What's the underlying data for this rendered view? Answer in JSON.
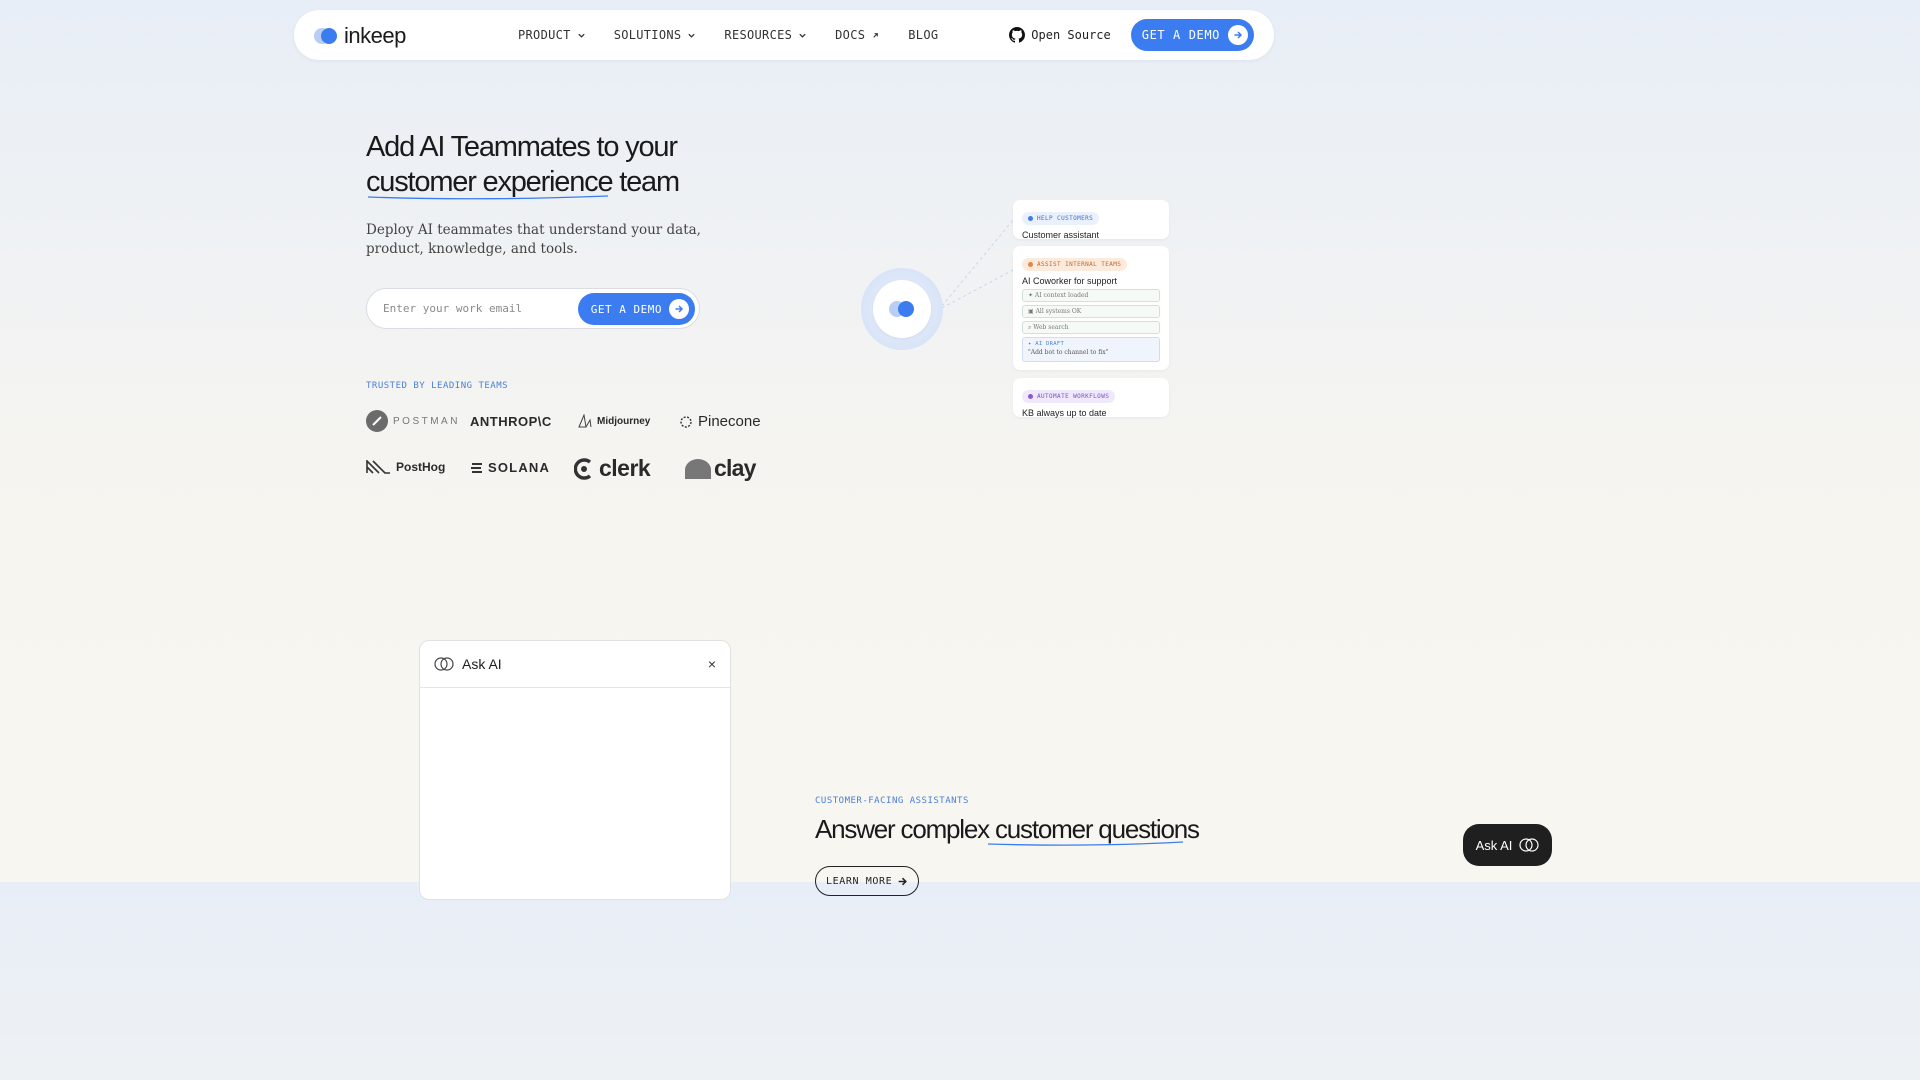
{
  "nav": {
    "logo_text": "inkeep",
    "menu": [
      {
        "label": "PRODUCT",
        "has_dropdown": true
      },
      {
        "label": "SOLUTIONS",
        "has_dropdown": true
      },
      {
        "label": "RESOURCES",
        "has_dropdown": true
      },
      {
        "label": "DOCS",
        "external": true
      },
      {
        "label": "BLOG"
      }
    ],
    "open_source_label": "Open Source",
    "demo_label": "GET A DEMO"
  },
  "hero": {
    "title_line1": "Add AI Teammates to your",
    "title_line2": "customer experience team",
    "subtitle": "Deploy AI teammates that understand your data, product, knowledge, and tools.",
    "email_placeholder": "Enter your work email",
    "form_button": "GET A DEMO",
    "trusted_label": "TRUSTED BY LEADING TEAMS",
    "brands": [
      "POSTMAN",
      "ANTHROP\\C",
      "Midjourney",
      "Pinecone",
      "PostHog",
      "SOLANA",
      "clerk",
      "clay"
    ]
  },
  "illustration": {
    "cards": [
      {
        "pill": "HELP CUSTOMERS",
        "title": "Customer assistant",
        "color": "#3b7df0"
      },
      {
        "pill": "ASSIST INTERNAL TEAMS",
        "title": "AI Coworker for support",
        "color": "#e8873a",
        "rows": [
          "✦ AI context loaded",
          "All systems OK",
          "Web search"
        ],
        "draft_label": "✦ AI DRAFT",
        "draft_text": "\"Add bot to channel to fix\""
      },
      {
        "pill": "AUTOMATE WORKFLOWS",
        "title": "KB always up to date",
        "color": "#8a5bd6"
      }
    ]
  },
  "ask_panel": {
    "title": "Ask AI",
    "close": "×"
  },
  "section": {
    "label": "CUSTOMER-FACING ASSISTANTS",
    "title_plain": "Answer complex",
    "title_highlight": "customer questions",
    "learn_more": "LEARN MORE"
  },
  "float_button": {
    "label": "Ask AI"
  },
  "colors": {
    "accent": "#3b7df0",
    "label_blue": "#4a7fd6"
  }
}
